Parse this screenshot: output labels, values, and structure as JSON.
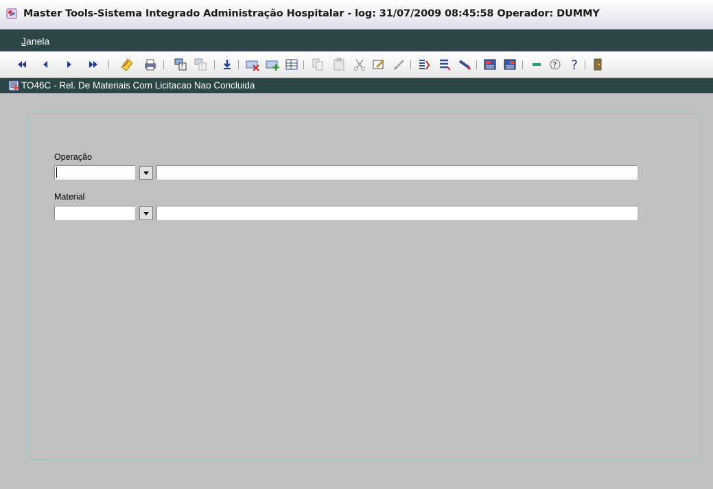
{
  "app": {
    "title": "Master Tools-Sistema Integrado Administração Hospitalar -  log: 31/07/2009 08:45:58 Operador: DUMMY"
  },
  "menu": {
    "items": [
      {
        "mnemonic": "J",
        "rest": "anela"
      }
    ]
  },
  "toolbar": {
    "buttons": [
      "first-record-icon",
      "previous-record-icon",
      "next-record-icon",
      "last-record-icon",
      "open-folder-icon",
      "print-icon",
      "query-icon",
      "query-disabled-icon",
      "save-arrow-icon",
      "delete-record-icon",
      "insert-record-icon",
      "grid-icon",
      "copy-icon",
      "paste-icon",
      "cut-icon",
      "edit-icon",
      "edit-disabled-icon",
      "list-icon",
      "form-icon",
      "pencil-icon",
      "calculator-icon",
      "calculator-2-icon",
      "minimize-icon",
      "help-topics-icon",
      "help-icon",
      "exit-icon"
    ]
  },
  "window": {
    "title": "TO46C - Rel. De Materiais Com Licitacao Nao Concluida"
  },
  "form": {
    "operacao": {
      "label": "Operação",
      "code": "",
      "description": ""
    },
    "material": {
      "label": "Material",
      "code": "",
      "description": ""
    }
  },
  "colors": {
    "menu_bg": "#2c4647",
    "background": "#c0c0c0",
    "panel_border": "#9ec8c8",
    "nav_arrows": "#1f3e9c"
  }
}
